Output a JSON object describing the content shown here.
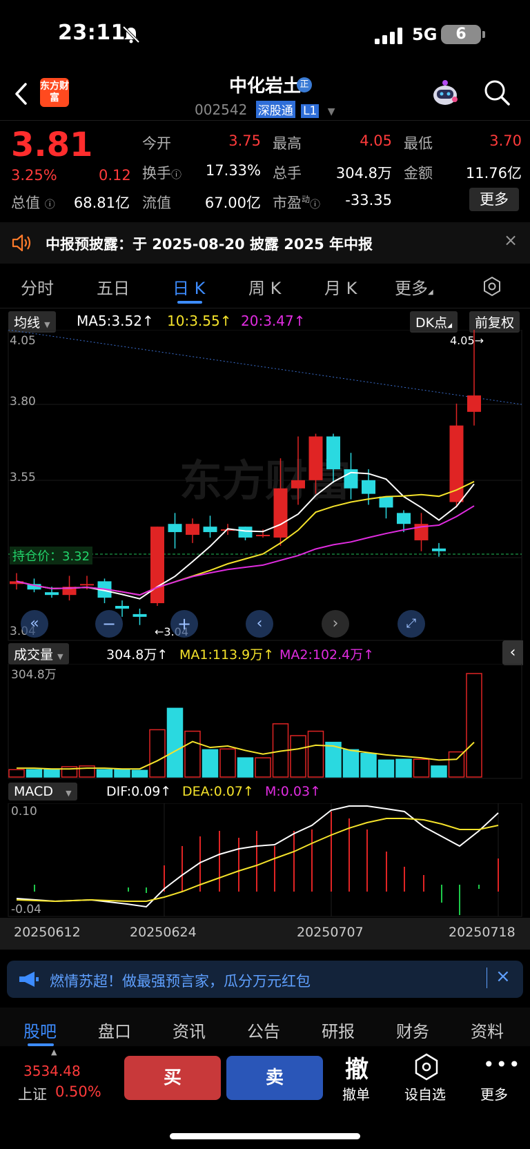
{
  "status_bar": {
    "time": "23:11",
    "network": "5G",
    "battery": "6"
  },
  "header": {
    "logo_text": "东方财富",
    "stock_name": "中化岩土",
    "badge": "正",
    "code": "002542",
    "tag1": "深股通",
    "tag2": "L1"
  },
  "quote": {
    "price": "3.81",
    "change_pct": "3.25%",
    "change": "0.12",
    "open_label": "今开",
    "open": "3.75",
    "high_label": "最高",
    "high": "4.05",
    "low_label": "最低",
    "low": "3.70",
    "turnover_label": "换手",
    "turnover": "17.33%",
    "volume_label": "总手",
    "volume": "304.8万",
    "amount_label": "金额",
    "amount": "11.76亿",
    "mcap_label": "总值",
    "mcap": "68.81亿",
    "float_label": "流值",
    "float": "67.00亿",
    "pe_label": "市盈",
    "pe_sup": "动",
    "pe": "-33.35",
    "more": "更多"
  },
  "notice": {
    "text": "中报预披露：于 2025-08-20 披露 2025 年中报"
  },
  "tabs": [
    "分时",
    "五日",
    "日 K",
    "周 K",
    "月 K",
    "更多"
  ],
  "ma_bar": {
    "select": "均线",
    "ma5": "MA5:3.52",
    "ma10": "10:3.55",
    "ma20": "20:3.47",
    "dk": "DK点",
    "fq": "前复权"
  },
  "kline": {
    "y_top": "4.05",
    "y_mid1": "3.80",
    "y_mid2": "3.55",
    "y_bot": "3.04",
    "max_label": "4.05",
    "min_label": "3.04",
    "cost_label": "持仓价：3.32",
    "watermark": "东方财富"
  },
  "volume_bar": {
    "select": "成交量",
    "val": "304.8万",
    "ma1": "MA1:113.9万",
    "ma2": "MA2:102.4万",
    "axis_top": "304.8万"
  },
  "macd_bar": {
    "select": "MACD",
    "dif": "DIF:0.09",
    "dea": "DEA:0.07",
    "m": "M:0.03",
    "axis_top": "0.10",
    "axis_bot": "-0.04"
  },
  "x_dates": [
    "20250612",
    "20250624",
    "20250707",
    "20250718"
  ],
  "banner": {
    "text": "燃情苏超！做最强预言家，瓜分万元红包"
  },
  "bottom_tabs": [
    "股吧",
    "盘口",
    "资讯",
    "公告",
    "研报",
    "财务",
    "资料"
  ],
  "index": {
    "value": "3534.48",
    "name": "上证",
    "pct": "0.50%"
  },
  "actions": {
    "buy": "买",
    "sell": "卖",
    "cancel_glyph": "撤",
    "cancel": "撤单",
    "watch": "设自选",
    "more": "更多"
  },
  "chart_data": {
    "type": "candlestick",
    "ylim": [
      3.04,
      4.05
    ],
    "candles": [
      {
        "o": 3.12,
        "c": 3.13,
        "h": 3.16,
        "l": 3.1
      },
      {
        "o": 3.12,
        "c": 3.1,
        "h": 3.14,
        "l": 3.09
      },
      {
        "o": 3.09,
        "c": 3.08,
        "h": 3.11,
        "l": 3.07
      },
      {
        "o": 3.08,
        "c": 3.11,
        "h": 3.15,
        "l": 3.06
      },
      {
        "o": 3.12,
        "c": 3.12,
        "h": 3.15,
        "l": 3.1
      },
      {
        "o": 3.13,
        "c": 3.07,
        "h": 3.14,
        "l": 3.05
      },
      {
        "o": 3.04,
        "c": 3.03,
        "h": 3.06,
        "l": 3.0
      },
      {
        "o": 3.01,
        "c": 3.0,
        "h": 3.03,
        "l": 2.97
      },
      {
        "o": 3.05,
        "c": 3.33,
        "h": 3.33,
        "l": 3.04
      },
      {
        "o": 3.34,
        "c": 3.31,
        "h": 3.38,
        "l": 3.25
      },
      {
        "o": 3.3,
        "c": 3.34,
        "h": 3.36,
        "l": 3.27
      },
      {
        "o": 3.33,
        "c": 3.31,
        "h": 3.37,
        "l": 3.29
      },
      {
        "o": 3.32,
        "c": 3.32,
        "h": 3.34,
        "l": 3.3
      },
      {
        "o": 3.33,
        "c": 3.29,
        "h": 3.33,
        "l": 3.28
      },
      {
        "o": 3.3,
        "c": 3.3,
        "h": 3.32,
        "l": 3.29
      },
      {
        "o": 3.29,
        "c": 3.47,
        "h": 3.58,
        "l": 3.26
      },
      {
        "o": 3.47,
        "c": 3.5,
        "h": 3.66,
        "l": 3.41
      },
      {
        "o": 3.5,
        "c": 3.66,
        "h": 3.67,
        "l": 3.45
      },
      {
        "o": 3.66,
        "c": 3.54,
        "h": 3.67,
        "l": 3.49
      },
      {
        "o": 3.54,
        "c": 3.47,
        "h": 3.6,
        "l": 3.43
      },
      {
        "o": 3.5,
        "c": 3.45,
        "h": 3.54,
        "l": 3.41
      },
      {
        "o": 3.44,
        "c": 3.4,
        "h": 3.44,
        "l": 3.36
      },
      {
        "o": 3.38,
        "c": 3.34,
        "h": 3.39,
        "l": 3.31
      },
      {
        "o": 3.28,
        "c": 3.34,
        "h": 3.38,
        "l": 3.24
      },
      {
        "o": 3.25,
        "c": 3.24,
        "h": 3.27,
        "l": 3.22
      },
      {
        "o": 3.42,
        "c": 3.7,
        "h": 3.78,
        "l": 3.4
      },
      {
        "o": 3.75,
        "c": 3.81,
        "h": 4.05,
        "l": 3.7
      }
    ],
    "volumes": [
      10,
      10,
      11,
      14,
      15,
      10,
      10,
      9,
      64,
      93,
      62,
      37,
      38,
      26,
      26,
      72,
      56,
      62,
      47,
      37,
      32,
      23,
      24,
      24,
      15,
      34,
      140
    ],
    "vol_ma": [
      12,
      12,
      11,
      11,
      12,
      12,
      11,
      11,
      22,
      35,
      48,
      40,
      42,
      36,
      31,
      35,
      38,
      43,
      42,
      36,
      33,
      30,
      28,
      26,
      23,
      24,
      47
    ]
  }
}
